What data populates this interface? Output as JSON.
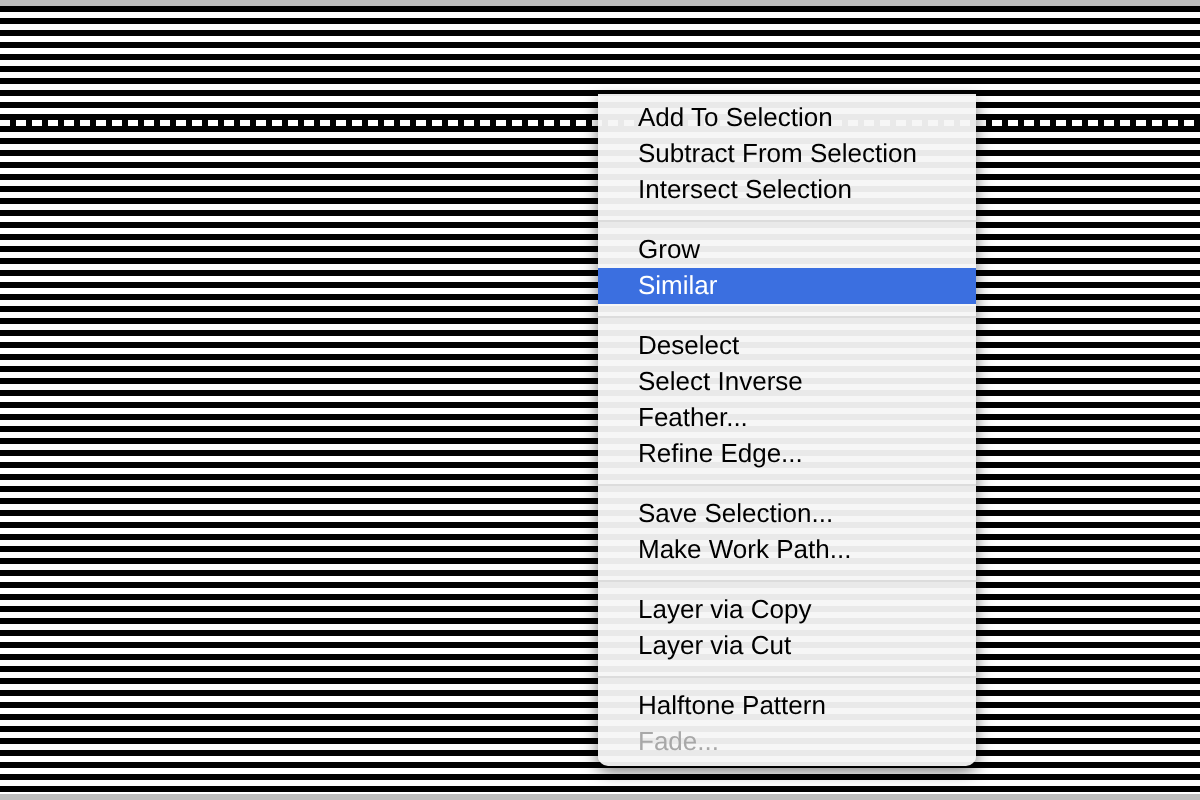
{
  "context_menu": {
    "groups": [
      {
        "items": [
          {
            "label": "Add To Selection",
            "selected": false,
            "disabled": false
          },
          {
            "label": "Subtract From Selection",
            "selected": false,
            "disabled": false
          },
          {
            "label": "Intersect Selection",
            "selected": false,
            "disabled": false
          }
        ]
      },
      {
        "items": [
          {
            "label": "Grow",
            "selected": false,
            "disabled": false
          },
          {
            "label": "Similar",
            "selected": true,
            "disabled": false
          }
        ]
      },
      {
        "items": [
          {
            "label": "Deselect",
            "selected": false,
            "disabled": false
          },
          {
            "label": "Select Inverse",
            "selected": false,
            "disabled": false
          },
          {
            "label": "Feather...",
            "selected": false,
            "disabled": false
          },
          {
            "label": "Refine Edge...",
            "selected": false,
            "disabled": false
          }
        ]
      },
      {
        "items": [
          {
            "label": "Save Selection...",
            "selected": false,
            "disabled": false
          },
          {
            "label": "Make Work Path...",
            "selected": false,
            "disabled": false
          }
        ]
      },
      {
        "items": [
          {
            "label": "Layer via Copy",
            "selected": false,
            "disabled": false
          },
          {
            "label": "Layer via Cut",
            "selected": false,
            "disabled": false
          }
        ]
      },
      {
        "items": [
          {
            "label": "Halftone Pattern",
            "selected": false,
            "disabled": false
          },
          {
            "label": "Fade...",
            "selected": false,
            "disabled": true
          }
        ]
      }
    ]
  }
}
